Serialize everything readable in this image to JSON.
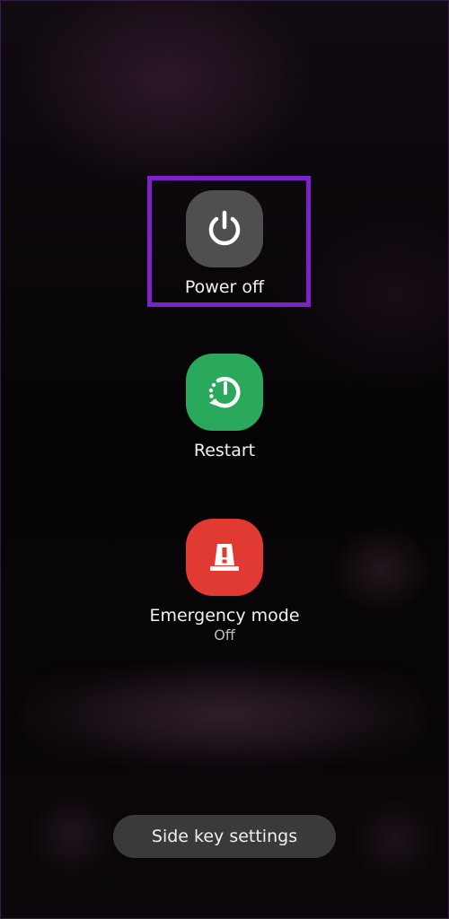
{
  "colors": {
    "power_tile": "#4f4f52",
    "restart_tile": "#2aa95c",
    "emergency_tile": "#e03a33",
    "highlight": "#7b22c9",
    "button_bg": "#3a3a3c"
  },
  "actions": {
    "power": {
      "label": "Power off",
      "icon": "power-icon"
    },
    "restart": {
      "label": "Restart",
      "icon": "restart-icon"
    },
    "emergency": {
      "label": "Emergency mode",
      "status": "Off",
      "icon": "emergency-light-icon"
    }
  },
  "footer": {
    "side_key_label": "Side key settings"
  }
}
